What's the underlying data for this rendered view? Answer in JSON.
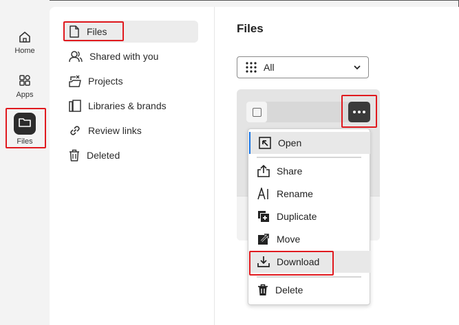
{
  "rail": {
    "home_label": "Home",
    "apps_label": "Apps",
    "files_label": "Files"
  },
  "nav": {
    "items": [
      {
        "label": "Files",
        "icon": "file-icon"
      },
      {
        "label": "Shared with you",
        "icon": "people-icon"
      },
      {
        "label": "Projects",
        "icon": "projects-icon"
      },
      {
        "label": "Libraries & brands",
        "icon": "libraries-icon"
      },
      {
        "label": "Review links",
        "icon": "link-icon"
      },
      {
        "label": "Deleted",
        "icon": "trash-icon"
      }
    ]
  },
  "main": {
    "title": "Files",
    "filter_value": "All"
  },
  "menu": {
    "items": [
      {
        "label": "Open",
        "icon": "open-icon"
      },
      {
        "label": "Share",
        "icon": "share-icon"
      },
      {
        "label": "Rename",
        "icon": "rename-icon"
      },
      {
        "label": "Duplicate",
        "icon": "duplicate-icon"
      },
      {
        "label": "Move",
        "icon": "move-icon"
      },
      {
        "label": "Download",
        "icon": "download-icon"
      },
      {
        "label": "Delete",
        "icon": "trash-icon"
      }
    ]
  },
  "colors": {
    "highlight": "#e0191e",
    "focus": "#1473e6",
    "dark_tile": "#2c2c2c"
  }
}
